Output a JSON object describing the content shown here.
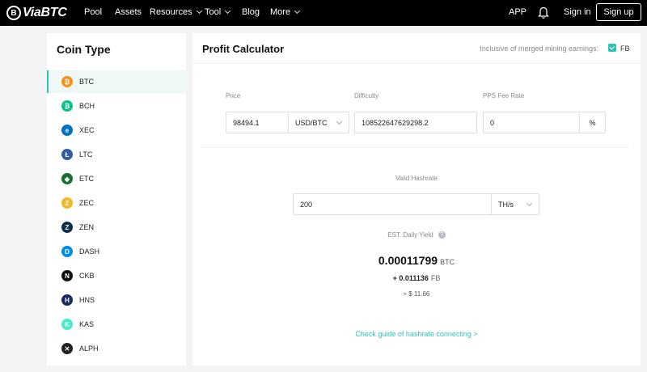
{
  "nav": {
    "logo_text": "ViaBTC",
    "logo_mark": "B",
    "items": [
      "Pool",
      "Assets",
      "Resources",
      "Tool",
      "Blog",
      "More"
    ],
    "app": "APP",
    "signin": "Sign in",
    "signup": "Sign up"
  },
  "sidebar": {
    "title": "Coin Type",
    "coins": [
      {
        "label": "BTC",
        "icon": "btc-icon",
        "glyph": "₿",
        "color": "#f7931a"
      },
      {
        "label": "BCH",
        "icon": "bch-icon",
        "glyph": "₿",
        "color": "#0ac18e"
      },
      {
        "label": "XEC",
        "icon": "xec-icon",
        "glyph": "e",
        "color": "#0074c2"
      },
      {
        "label": "LTC",
        "icon": "ltc-icon",
        "glyph": "Ł",
        "color": "#345d9d"
      },
      {
        "label": "ETC",
        "icon": "etc-icon",
        "glyph": "◆",
        "color": "#1a6e2f"
      },
      {
        "label": "ZEC",
        "icon": "zec-icon",
        "glyph": "Z",
        "color": "#f4b728"
      },
      {
        "label": "ZEN",
        "icon": "zen-icon",
        "glyph": "Z",
        "color": "#0e2f4a"
      },
      {
        "label": "DASH",
        "icon": "dash-icon",
        "glyph": "D",
        "color": "#008ce7"
      },
      {
        "label": "CKB",
        "icon": "ckb-icon",
        "glyph": "N",
        "color": "#111111"
      },
      {
        "label": "HNS",
        "icon": "hns-icon",
        "glyph": "H",
        "color": "#1c2a5e"
      },
      {
        "label": "KAS",
        "icon": "kas-icon",
        "glyph": "K",
        "color": "#49eacb"
      },
      {
        "label": "ALPH",
        "icon": "alph-icon",
        "glyph": "✕",
        "color": "#222222"
      }
    ]
  },
  "main": {
    "title": "Profit Calculator",
    "merged_label": "Inclusive of merged mining earnings:",
    "fb_label": "FB",
    "price_label": "Price",
    "price_value": "98494.1",
    "price_unit": "USD/BTC",
    "difficulty_label": "Difficulty",
    "difficulty_value": "108522647629298.2",
    "fee_label": "PPS Fee Rate",
    "fee_value": "0",
    "fee_unit": "%",
    "hashrate_label": "Valid Hashrate",
    "hashrate_value": "200",
    "hashrate_unit": "TH/s",
    "yield_label": "EST. Daily Yield",
    "yield_value": "0.00011799",
    "yield_unit": "BTC",
    "fb_yield_value": "+ 0.011136",
    "fb_yield_unit": "FB",
    "usd_value": "≈ $ 11.66",
    "guide_link": "Check guide of hashrate connecting >"
  },
  "colors": {
    "accent": "#2bc4b4",
    "nav_bg": "#000000"
  }
}
